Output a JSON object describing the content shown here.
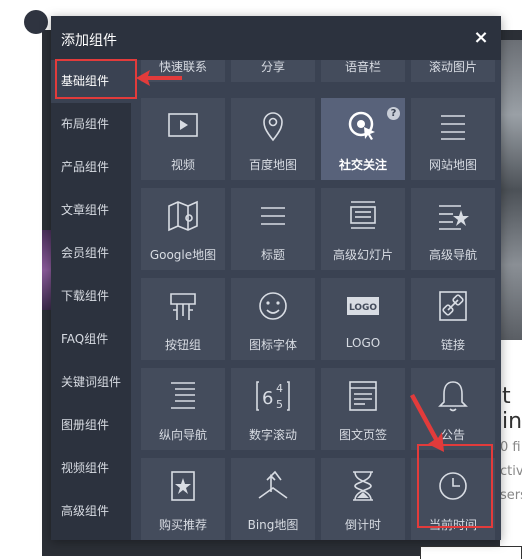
{
  "dialog": {
    "title": "添加组件",
    "close_icon": "×"
  },
  "sidebar": {
    "items": [
      {
        "label": "基础组件",
        "active": true
      },
      {
        "label": "布局组件"
      },
      {
        "label": "产品组件"
      },
      {
        "label": "文章组件"
      },
      {
        "label": "会员组件"
      },
      {
        "label": "下载组件"
      },
      {
        "label": "FAQ组件"
      },
      {
        "label": "关键词组件"
      },
      {
        "label": "图册组件"
      },
      {
        "label": "视频组件"
      },
      {
        "label": "高级组件"
      }
    ]
  },
  "tiles_top_partial": [
    "快速联系",
    "分享",
    "语音栏",
    "滚动图片"
  ],
  "tiles": [
    {
      "label": "视频",
      "icon": "video-play-icon"
    },
    {
      "label": "百度地图",
      "icon": "map-pin-icon"
    },
    {
      "label": "社交关注",
      "icon": "social-follow-icon",
      "active": true,
      "help": "?"
    },
    {
      "label": "网站地图",
      "icon": "sitemap-list-icon"
    },
    {
      "label": "Google地图",
      "icon": "folded-map-icon"
    },
    {
      "label": "标题",
      "icon": "title-lines-icon"
    },
    {
      "label": "高级幻灯片",
      "icon": "slideshow-icon"
    },
    {
      "label": "高级导航",
      "icon": "nav-star-icon"
    },
    {
      "label": "按钮组",
      "icon": "button-group-icon"
    },
    {
      "label": "图标字体",
      "icon": "smiley-icon"
    },
    {
      "label": "LOGO",
      "icon": "logo-badge-icon",
      "logo_text": "LOGO"
    },
    {
      "label": "链接",
      "icon": "link-icon"
    },
    {
      "label": "纵向导航",
      "icon": "vertical-nav-icon"
    },
    {
      "label": "数字滚动",
      "icon": "number-roll-icon"
    },
    {
      "label": "图文页签",
      "icon": "image-text-tab-icon"
    },
    {
      "label": "公告",
      "icon": "bell-icon"
    },
    {
      "label": "购买推荐",
      "icon": "bookmark-star-icon"
    },
    {
      "label": "Bing地图",
      "icon": "bing-icon"
    },
    {
      "label": "倒计时",
      "icon": "hourglass-icon"
    },
    {
      "label": "当前时间",
      "icon": "clock-icon"
    }
  ],
  "background": {
    "heading_fragment": "t in",
    "line1": "0 fi",
    "line2": "ctiv",
    "line3": "sers"
  },
  "colors": {
    "dialog_bg": "#3a4252",
    "header_bg": "#2c323e",
    "tile_bg": "#444c5c",
    "tile_active_bg": "#58627a",
    "annotation_red": "#e23b3b"
  }
}
